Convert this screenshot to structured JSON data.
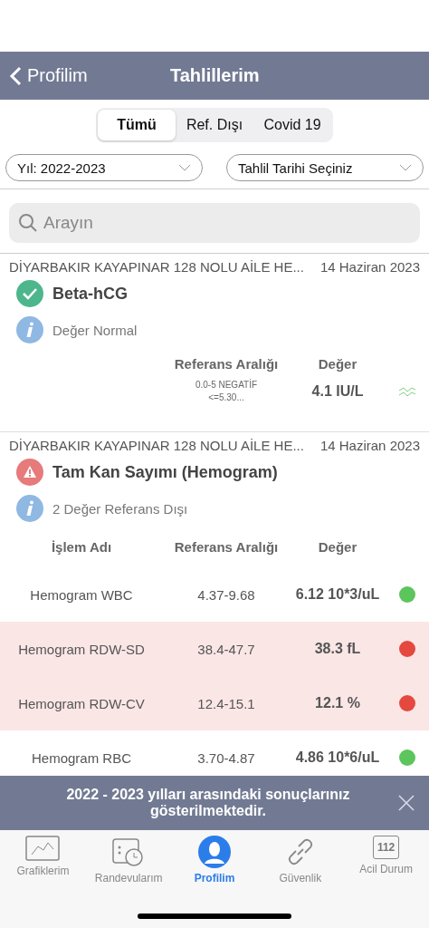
{
  "nav": {
    "back_label": "Profilim",
    "title": "Tahlillerim"
  },
  "segments": [
    {
      "label": "Tümü",
      "selected": true
    },
    {
      "label": "Ref. Dışı",
      "selected": false
    },
    {
      "label": "Covid 19",
      "selected": false
    }
  ],
  "filters": [
    {
      "value": "Yıl: 2022-2023"
    },
    {
      "value": "Tahlil Tarihi Seçiniz"
    }
  ],
  "search": {
    "placeholder": "Arayın"
  },
  "results": [
    {
      "kind": "single",
      "institution": "DİYARBAKIR KAYAPINAR 128 NOLU AİLE HE...",
      "date": "14 Haziran 2023",
      "status_icon": {
        "kind": "check"
      },
      "title": "Beta-hCG",
      "info": "Değer Normal",
      "ref_header": "Referans Aralığı",
      "value_header": "Değer",
      "ref": "0.0-5 NEGATİF\n<=5.30...",
      "value": "4.1 IU/L"
    },
    {
      "kind": "table",
      "institution": "DİYARBAKIR KAYAPINAR 128 NOLU AİLE HE...",
      "date": "14 Haziran 2023",
      "status_icon": {
        "kind": "warning"
      },
      "title": "Tam Kan Sayımı (Hemogram)",
      "info": "2 Değer Referans Dışı",
      "name_header": "İşlem Adı",
      "ref_header": "Referans Aralığı",
      "value_header": "Değer",
      "rows": [
        {
          "name": "Hemogram WBC",
          "ref": "4.37-9.68",
          "value": "6.12 10*3/uL",
          "out_of_range": false,
          "color": "#5cc55c"
        },
        {
          "name": "Hemogram RDW-SD",
          "ref": "38.4-47.7",
          "value": "38.3 fL",
          "out_of_range": true,
          "color": "#e5483f"
        },
        {
          "name": "Hemogram RDW-CV",
          "ref": "12.4-15.1",
          "value": "12.1 %",
          "out_of_range": true,
          "color": "#e5483f"
        },
        {
          "name": "Hemogram RBC",
          "ref": "3.70-4.87",
          "value": "4.86 10*6/uL",
          "out_of_range": false,
          "color": "#5cc55c"
        }
      ]
    }
  ],
  "banner": {
    "text": "2022 - 2023 yılları arasındaki sonuçlarınız gösterilmektedir."
  },
  "tabbar": [
    {
      "label": "Grafiklerim",
      "kind": "chart",
      "selected": false
    },
    {
      "label": "Randevularım",
      "kind": "calendar",
      "selected": false
    },
    {
      "label": "Profilim",
      "kind": "person",
      "selected": true
    },
    {
      "label": "Güvenlik",
      "kind": "link",
      "selected": false
    },
    {
      "label": "Acil Durum",
      "kind": "badge",
      "badge": "112",
      "selected": false
    }
  ]
}
